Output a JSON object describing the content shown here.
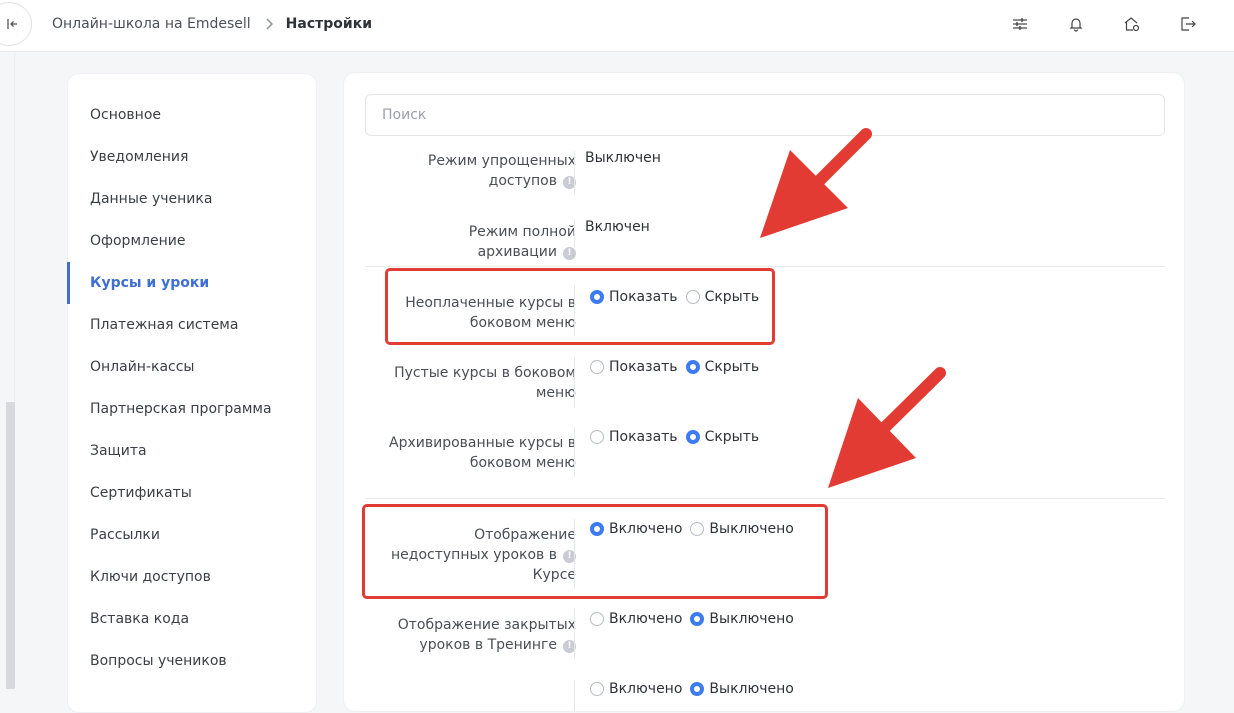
{
  "breadcrumb": {
    "school": "Онлайн-школа на Emdesell",
    "current": "Настройки"
  },
  "sidebar": {
    "items": [
      {
        "label": "Основное"
      },
      {
        "label": "Уведомления"
      },
      {
        "label": "Данные ученика"
      },
      {
        "label": "Оформление"
      },
      {
        "label": "Курсы и уроки",
        "active": true
      },
      {
        "label": "Платежная система"
      },
      {
        "label": "Онлайн-кассы"
      },
      {
        "label": "Партнерская программа"
      },
      {
        "label": "Защита"
      },
      {
        "label": "Сертификаты"
      },
      {
        "label": "Рассылки"
      },
      {
        "label": "Ключи доступов"
      },
      {
        "label": "Вставка кода"
      },
      {
        "label": "Вопросы учеников"
      }
    ]
  },
  "search": {
    "placeholder": "Поиск"
  },
  "settings": {
    "simplified_access": {
      "label_line1": "Режим упрощенных",
      "label_line2": "доступов",
      "value": "Выключен"
    },
    "full_archive": {
      "label": "Режим полной архивации",
      "value": "Включен"
    },
    "unpaid_courses": {
      "label_line1": "Неоплаченные курсы в",
      "label_line2": "боковом меню",
      "option_show": "Показать",
      "option_hide": "Скрыть",
      "selected": "show"
    },
    "empty_courses": {
      "label_line1": "Пустые курсы в боковом",
      "label_line2": "меню",
      "option_show": "Показать",
      "option_hide": "Скрыть",
      "selected": "hide"
    },
    "archived_courses": {
      "label_line1": "Архивированные курсы в",
      "label_line2": "боковом меню",
      "option_show": "Показать",
      "option_hide": "Скрыть",
      "selected": "hide"
    },
    "unavailable_lessons": {
      "label_line1": "Отображение",
      "label_line2": "недоступных уроков в",
      "label_line3": "Курсе",
      "option_on": "Включено",
      "option_off": "Выключено",
      "selected": "on"
    },
    "closed_lessons": {
      "label_line1": "Отображение закрытых",
      "label_line2": "уроков в Тренинге",
      "option_on": "Включено",
      "option_off": "Выключено",
      "selected": "off"
    },
    "next_row": {
      "option_on": "Включено",
      "option_off": "Выключено",
      "selected": "off"
    }
  },
  "colors": {
    "accent": "#3e6fd1",
    "radio": "#3d7bf0",
    "annotation_red": "#e23b33"
  }
}
